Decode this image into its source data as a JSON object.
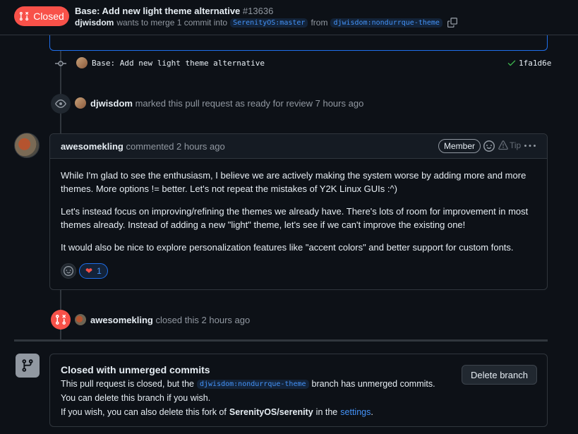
{
  "header": {
    "state": "Closed",
    "title": "Base: Add new light theme alternative",
    "number": "#13636",
    "author": "djwisdom",
    "merge_text": "wants to merge 1 commit into",
    "base_branch": "SerenityOS:master",
    "from_text": "from",
    "head_branch": "djwisdom:nondurrque-theme"
  },
  "commit": {
    "message": "Base: Add new light theme alternative",
    "sha": "1fa1d6e"
  },
  "ready_event": {
    "user": "djwisdom",
    "text": "marked this pull request as ready for review 7 hours ago"
  },
  "comment": {
    "author": "awesomekling",
    "meta": "commented 2 hours ago",
    "badge": "Member",
    "tip": "Tip",
    "paragraphs": [
      "While I'm glad to see the enthusiasm, I believe we are actively making the system worse by adding more and more themes. More options != better. Let's not repeat the mistakes of Y2K Linux GUIs :^)",
      "Let's instead focus on improving/refining the themes we already have. There's lots of room for improvement in most themes already. Instead of adding a new \"light\" theme, let's see if we can't improve the existing one!",
      "It would also be nice to explore personalization features like \"accent colors\" and better support for custom fonts."
    ],
    "reaction_count": "1"
  },
  "closed_event": {
    "user": "awesomekling",
    "text": "closed this 2 hours ago"
  },
  "merge_box": {
    "title": "Closed with unmerged commits",
    "line1_pre": "This pull request is closed, but the",
    "line1_branch": "djwisdom:nondurrque-theme",
    "line1_post": "branch has unmerged commits.",
    "line2": "You can delete this branch if you wish.",
    "line3_pre": "If you wish, you can also delete this fork of",
    "line3_repo": "SerenityOS/serenity",
    "line3_mid": "in the",
    "line3_link": "settings",
    "line3_end": ".",
    "delete_button": "Delete branch"
  },
  "colors": {
    "closed": "#f85149",
    "link": "#4493f8",
    "bg": "#0d1117",
    "border": "#30363d"
  }
}
